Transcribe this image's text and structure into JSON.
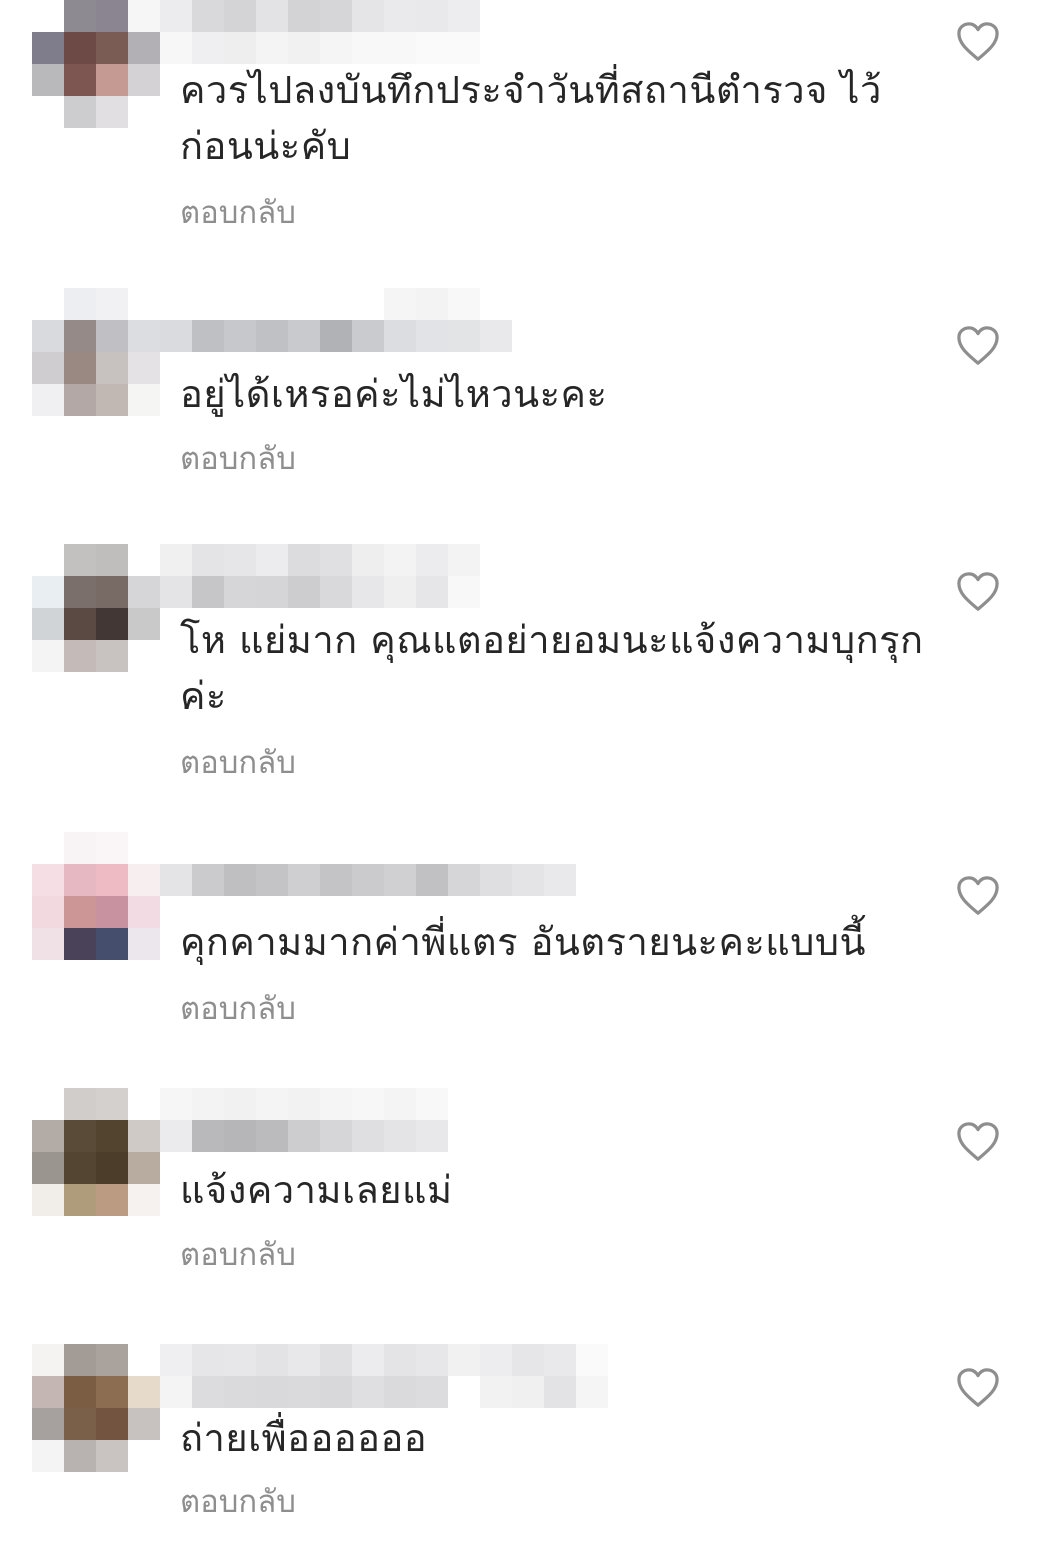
{
  "comments": [
    {
      "text": "ควรไปลงบันทึกประจำวันที่สถานีตำรวจ ไว้ก่อนน่ะคับ",
      "reply_label": "ตอบกลับ",
      "like_icon": "heart-outline-icon"
    },
    {
      "text": "อยู่ได้เหรอค่ะไม่ไหวนะคะ",
      "reply_label": "ตอบกลับ",
      "like_icon": "heart-outline-icon"
    },
    {
      "text": "โห แย่มาก คุณแตอย่ายอมนะแจ้งความบุกรุกค่ะ",
      "reply_label": "ตอบกลับ",
      "like_icon": "heart-outline-icon"
    },
    {
      "text": "คุกคามมากค่าพี่แตร อันตรายนะคะแบบนี้",
      "reply_label": "ตอบกลับ",
      "like_icon": "heart-outline-icon"
    },
    {
      "text": "แจ้งความเลยแม่",
      "reply_label": "ตอบกลับ",
      "like_icon": "heart-outline-icon"
    },
    {
      "text": "ถ่ายเพื่ออออออ",
      "reply_label": "ตอบกลับ",
      "like_icon": "heart-outline-icon"
    }
  ],
  "colors": {
    "text": "#262626",
    "secondary": "#8e8e8e",
    "icon": "#8e8e8e"
  }
}
